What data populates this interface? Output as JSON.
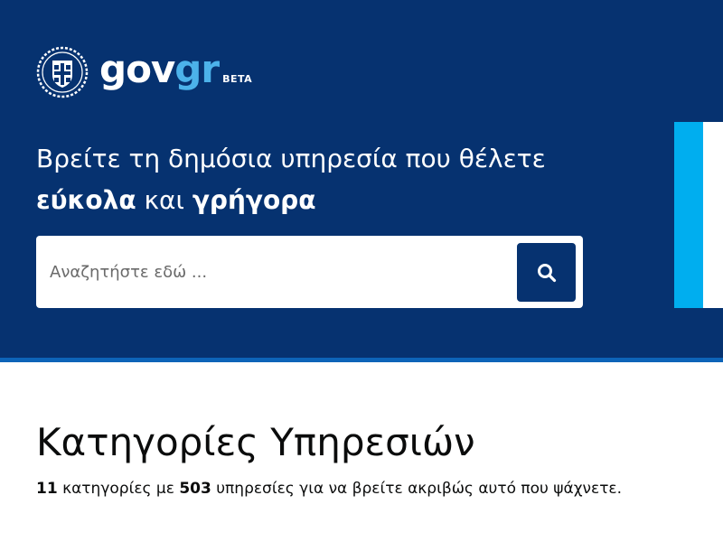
{
  "header": {
    "logo": {
      "emblem_icon": "greek-coat-of-arms-emblem",
      "wordmark_gov": "gov",
      "wordmark_gr": "gr",
      "badge": "BETA"
    },
    "hero": {
      "line1": "Βρείτε τη δημόσια υπηρεσία που θέλετε",
      "line2_bold1": "εύκολα",
      "line2_middle": "και",
      "line2_bold2": "γρήγορα"
    },
    "search": {
      "placeholder": "Αναζητήστε εδώ ...",
      "value": "",
      "button_icon": "search-icon"
    }
  },
  "main": {
    "title": "Κατηγορίες Υπηρεσιών",
    "summary": {
      "categories_count": "11",
      "categories_text": "κατηγορίες με",
      "services_count": "503",
      "services_text": "υπηρεσίες για να βρείτε ακριβώς αυτό που ψάχνετε."
    }
  },
  "colors": {
    "header_bg": "#063270",
    "header_stripe": "#0d64b8",
    "brand_light_blue": "#4cb2ea",
    "side_card_accent": "#00aeef",
    "text_dark": "#0b0c0c"
  }
}
